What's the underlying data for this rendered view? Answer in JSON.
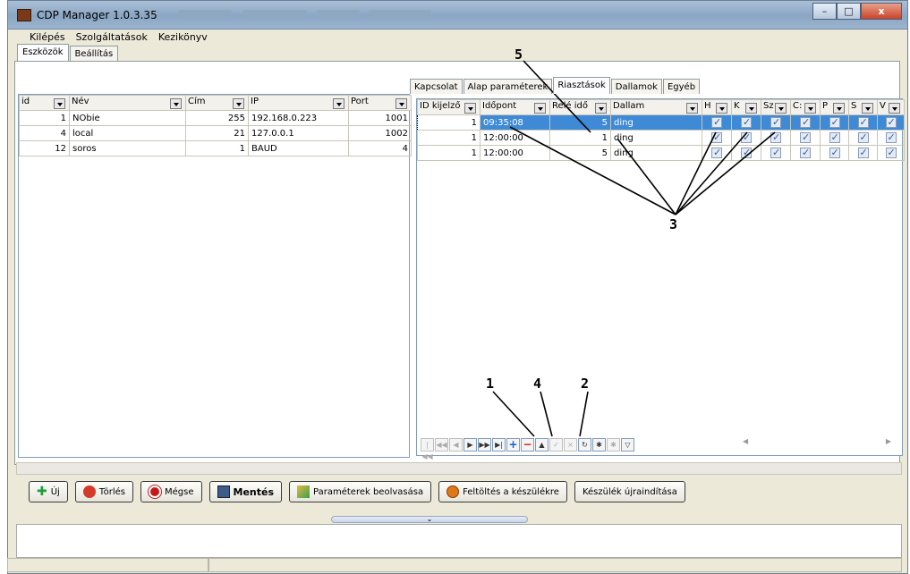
{
  "window": {
    "title": "CDP Manager 1.0.3.35",
    "min": "–",
    "max": "□",
    "close": "x"
  },
  "menu": [
    "Kilépés",
    "Szolgáltatások",
    "Kezikönyv"
  ],
  "main_tabs": [
    "Eszközök",
    "Beállítás"
  ],
  "left_grid": {
    "headers": [
      "id",
      "Név",
      "Cím",
      "IP",
      "Port"
    ],
    "rows": [
      [
        "1",
        "NObie",
        "255",
        "192.168.0.223",
        "1001"
      ],
      [
        "4",
        "local",
        "21",
        "127.0.0.1",
        "1002"
      ],
      [
        "12",
        "soros",
        "1",
        "BAUD",
        "4"
      ]
    ]
  },
  "right_tabs": [
    "Kapcsolat",
    "Alap paraméterek",
    "Riasztások",
    "Dallamok",
    "Egyéb"
  ],
  "alarm_grid": {
    "headers": [
      "ID kijelző",
      "Időpont",
      "Relé idő",
      "Dallam",
      "H",
      "K",
      "Sz",
      "C:",
      "P",
      "S",
      "V"
    ],
    "rows": [
      [
        "1",
        "09:35:08",
        "5",
        "ding"
      ],
      [
        "1",
        "12:00:00",
        "1",
        "ding"
      ],
      [
        "1",
        "12:00:00",
        "5",
        "ding"
      ]
    ]
  },
  "annotations": [
    "1",
    "2",
    "3",
    "4",
    "5"
  ],
  "buttons": [
    "Új",
    "Törlés",
    "Mégse",
    "Mentés",
    "Paraméterek beolvasása",
    "Feltöltés a készülékre",
    "Készülék újraindítása"
  ]
}
